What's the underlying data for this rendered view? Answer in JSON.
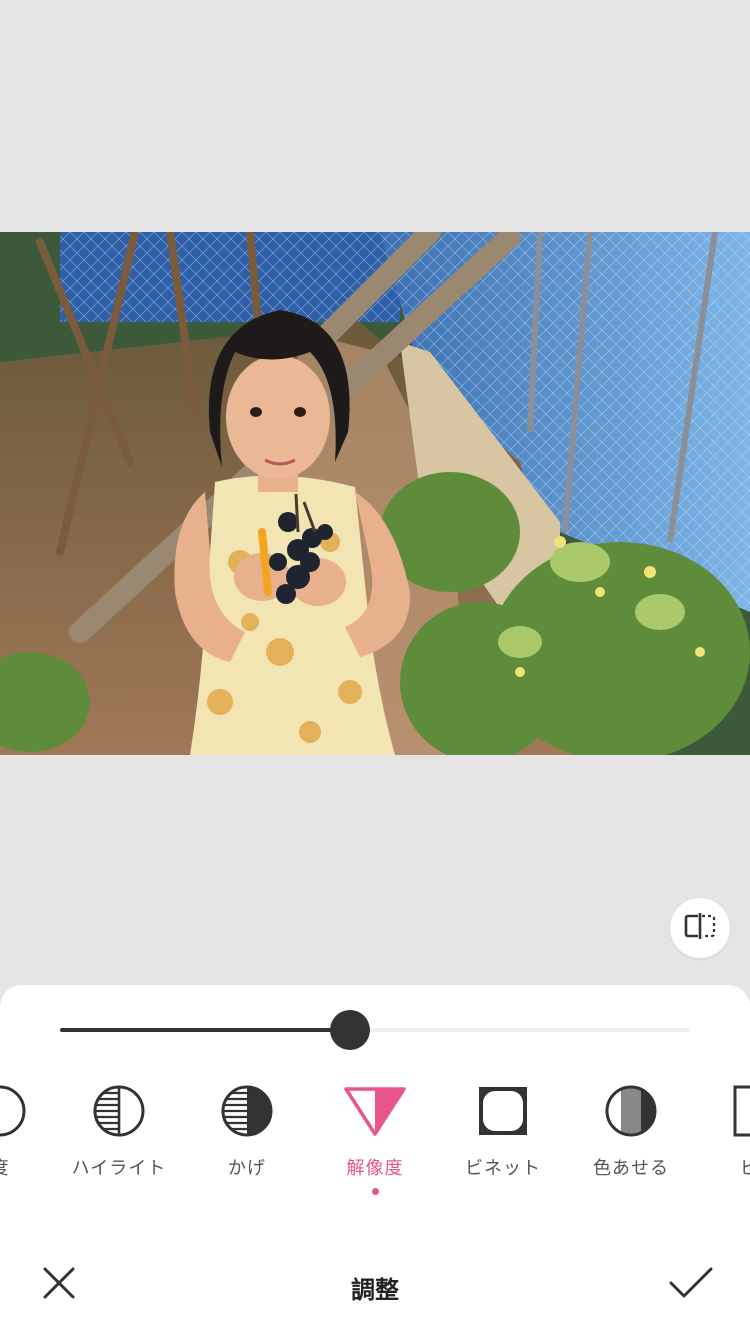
{
  "editor": {
    "title": "調整",
    "adjustment_level": 0.46,
    "colors": {
      "accent": "#e8558b",
      "dark": "#333333",
      "background": "#e5e5e5"
    }
  },
  "tools": [
    {
      "label": "度",
      "icon": "partial-circle-icon",
      "active": false
    },
    {
      "label": "ハイライト",
      "icon": "highlight-icon",
      "active": false
    },
    {
      "label": "かげ",
      "icon": "shadow-icon",
      "active": false
    },
    {
      "label": "解像度",
      "icon": "sharpness-triangle-icon",
      "active": true
    },
    {
      "label": "ビネット",
      "icon": "vignette-icon",
      "active": false
    },
    {
      "label": "色あせる",
      "icon": "fade-icon",
      "active": false
    },
    {
      "label": "ビン",
      "icon": "partial-square-icon",
      "active": false
    }
  ],
  "icons": {
    "compare": "compare-icon",
    "close": "close-icon",
    "confirm": "checkmark-icon"
  }
}
